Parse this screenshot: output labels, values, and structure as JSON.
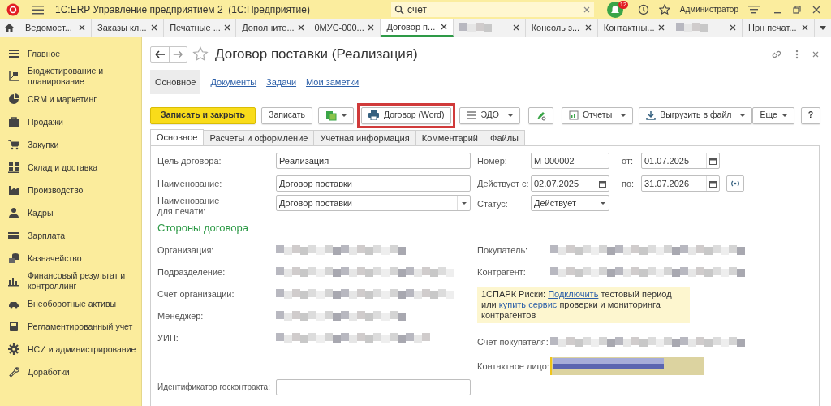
{
  "app": {
    "title": "1С:ERP Управление предприятием 2  (1С:Предприятие)",
    "search": "счет",
    "notifications": "12",
    "user": "Администратор"
  },
  "open_tabs": [
    {
      "label": "Ведомост...",
      "kind": "text",
      "selected": false
    },
    {
      "label": "Заказы кл...",
      "kind": "text",
      "selected": false
    },
    {
      "label": "Печатные ...",
      "kind": "text",
      "selected": false
    },
    {
      "label": "Дополните...",
      "kind": "text",
      "selected": false
    },
    {
      "label": "0МУС-000...",
      "kind": "text",
      "selected": false
    },
    {
      "label": "Договор п...",
      "kind": "text",
      "selected": true
    },
    {
      "kind": "redacted",
      "selected": false
    },
    {
      "label": "Консоль з...",
      "kind": "text",
      "selected": false
    },
    {
      "label": "Контактны...",
      "kind": "text",
      "selected": false
    },
    {
      "kind": "redacted",
      "selected": false
    },
    {
      "label": "Нрн печат...",
      "kind": "text",
      "selected": false
    }
  ],
  "sidebar": {
    "items": [
      {
        "label": "Главное"
      },
      {
        "label": "Бюджетирование и планирование"
      },
      {
        "label": "CRM и маркетинг"
      },
      {
        "label": "Продажи"
      },
      {
        "label": "Закупки"
      },
      {
        "label": "Склад и доставка"
      },
      {
        "label": "Производство"
      },
      {
        "label": "Кадры"
      },
      {
        "label": "Зарплата"
      },
      {
        "label": "Казначейство"
      },
      {
        "label": "Финансовый результат и контроллинг"
      },
      {
        "label": "Внеоборотные активы"
      },
      {
        "label": "Регламентированный учет"
      },
      {
        "label": "НСИ и администрирование"
      },
      {
        "label": "Доработки"
      }
    ]
  },
  "document": {
    "title": "Договор поставки (Реализация)",
    "sections": [
      {
        "label": "Основное",
        "selected": true
      },
      {
        "label": "Документы",
        "selected": false
      },
      {
        "label": "Задачи",
        "selected": false
      },
      {
        "label": "Мои заметки",
        "selected": false
      }
    ],
    "toolbar": [
      {
        "label": "Записать и закрыть",
        "kind": "primary"
      },
      {
        "label": "Записать",
        "kind": "plain"
      },
      {
        "kind": "create"
      },
      {
        "label": "Договор (Word)",
        "kind": "print",
        "highlighted": true
      },
      {
        "label": "ЭДО",
        "kind": "edo"
      },
      {
        "kind": "sign"
      },
      {
        "label": "Отчеты",
        "kind": "reports"
      },
      {
        "label": "Выгрузить в файл",
        "kind": "export"
      },
      {
        "label": "Еще",
        "kind": "more"
      },
      {
        "label": "?",
        "kind": "help"
      }
    ],
    "form_tabs": [
      {
        "label": "Основное",
        "selected": true
      },
      {
        "label": "Расчеты и оформление",
        "selected": false
      },
      {
        "label": "Учетная информация",
        "selected": false
      },
      {
        "label": "Комментарий",
        "selected": false
      },
      {
        "label": "Файлы",
        "selected": false
      }
    ],
    "fields": {
      "purpose": {
        "label": "Цель договора:",
        "value": "Реализация"
      },
      "name": {
        "label": "Наименование:",
        "value": "Договор поставки"
      },
      "print_name": {
        "label": "Наименование для печати:",
        "value": "Договор поставки"
      },
      "number": {
        "label": "Номер:",
        "value": "М-000002"
      },
      "date": {
        "label": "от:",
        "value": "01.07.2025"
      },
      "valid_from": {
        "label": "Действует с:",
        "value": "02.07.2025"
      },
      "valid_to": {
        "label": "по:",
        "value": "31.07.2026"
      },
      "status": {
        "label": "Статус:",
        "value": "Действует"
      }
    },
    "parties_heading": "Стороны договора",
    "parties_left": [
      {
        "label": "Организация:"
      },
      {
        "label": "Подразделение:"
      },
      {
        "label": "Счет организации:"
      },
      {
        "label": "Менеджер:"
      },
      {
        "label": "УИП:"
      }
    ],
    "parties_right": [
      {
        "label": "Покупатель:"
      },
      {
        "label": "Контрагент:"
      }
    ],
    "spark_notice": [
      {
        "kind": "text",
        "text": "1СПАРК Риски: "
      },
      {
        "kind": "link",
        "text": "Подключить"
      },
      {
        "kind": "text",
        "text": " тестовый период или "
      },
      {
        "kind": "link",
        "text": "купить сервис"
      },
      {
        "kind": "text",
        "text": " проверки и мониторинга контрагентов"
      }
    ],
    "buyer_account": {
      "label": "Счет покупателя:"
    },
    "contact": {
      "label": "Контактное лицо:"
    },
    "gov_id": {
      "label": "Идентификатор госконтракта:"
    }
  }
}
